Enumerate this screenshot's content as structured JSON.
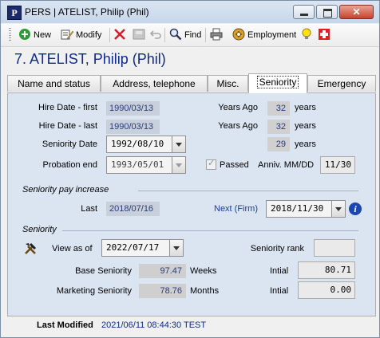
{
  "window": {
    "title": "PERS | ATELIST, Philip (Phil)",
    "close_glyph": "✕"
  },
  "toolbar": {
    "new_label": "New",
    "modify_label": "Modify",
    "find_label": "Find",
    "employment_label": "Employment",
    "icons": [
      "new-icon",
      "modify-icon",
      "delete-icon",
      "disabled-save-icon",
      "undo-icon",
      "find-icon",
      "print-icon",
      "employment-icon",
      "lightbulb-icon",
      "first-aid-icon"
    ]
  },
  "header": {
    "title": "7. ATELIST, Philip (Phil)"
  },
  "tabs": [
    {
      "label": "Name and status"
    },
    {
      "label": "Address, telephone"
    },
    {
      "label": "Misc."
    },
    {
      "label": "Seniority",
      "active": true
    },
    {
      "label": "Emergency"
    }
  ],
  "dates": {
    "hire_first_label": "Hire Date - first",
    "hire_first_value": "1990/03/13",
    "hire_last_label": "Hire Date - last",
    "hire_last_value": "1990/03/13",
    "seniority_date_label": "Seniority Date",
    "seniority_date_value": "1992/08/10",
    "probation_end_label": "Probation end",
    "probation_end_value": "1993/05/01",
    "passed_label": "Passed",
    "passed_checked": true,
    "anniv_label": "Anniv. MM/DD",
    "anniv_value": "11/30"
  },
  "years_ago": {
    "label1": "Years Ago",
    "value1": "32",
    "unit1": "years",
    "label2": "Years Ago",
    "value2": "32",
    "unit2": "years",
    "value3": "29",
    "unit3": "years"
  },
  "pay_increase": {
    "section_title": "Seniority pay increase",
    "last_label": "Last",
    "last_value": "2018/07/16",
    "next_label": "Next (Firm)",
    "next_value": "2018/11/30"
  },
  "seniority": {
    "section_title": "Seniority",
    "view_as_of_label": "View as of",
    "view_as_of_value": "2022/07/17",
    "rank_label": "Seniority rank",
    "rank_value": "",
    "base_label": "Base Seniority",
    "base_value": "97.47",
    "base_unit": "Weeks",
    "base_initial_label": "Intial",
    "base_initial_value": "80.71",
    "marketing_label": "Marketing Seniority",
    "marketing_value": "78.76",
    "marketing_unit": "Months",
    "marketing_initial_label": "Intial",
    "marketing_initial_value": "0.00"
  },
  "status": {
    "last_modified_label": "Last Modified",
    "last_modified_value": "2021/06/11 08:44:30 TEST"
  },
  "colors": {
    "heading": "#0d2b8c",
    "panel": "#dbe5f1",
    "link": "#1a3aa0"
  }
}
